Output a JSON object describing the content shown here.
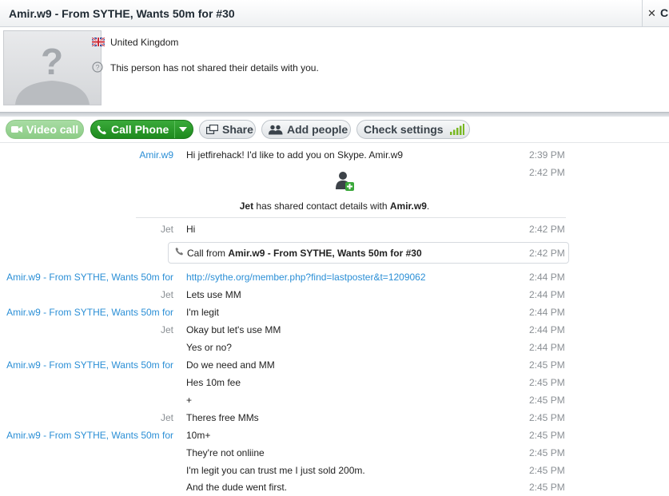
{
  "window": {
    "title": "Amir.w9 - From SYTHE, Wants 50m for #30",
    "next_tab": "C"
  },
  "profile": {
    "country": "United Kingdom",
    "privacy_note": "This person has not shared their details with you."
  },
  "toolbar": {
    "video_call": "Video call",
    "call_phone": "Call Phone",
    "share": "Share",
    "add_people": "Add people",
    "check_settings": "Check settings"
  },
  "messages": [
    {
      "sender": "Amir.w9",
      "side": "remote",
      "text": "Hi jetfirehack! I'd like to add you on Skype. Amir.w9",
      "time": "2:39 PM"
    },
    {
      "sender": "",
      "side": "local",
      "text": "",
      "time": "2:42 PM"
    },
    {
      "sender": "Jet",
      "side": "local",
      "text": "Hi",
      "time": "2:42 PM"
    },
    {
      "sender": "Amir.w9 - From SYTHE, Wants 50m for",
      "side": "remote",
      "text": "http://sythe.org/member.php?find=lastposter&t=1209062",
      "time": "2:44 PM",
      "link": true
    },
    {
      "sender": "Jet",
      "side": "local",
      "text": "Lets use MM",
      "time": "2:44 PM"
    },
    {
      "sender": "Amir.w9 - From SYTHE, Wants 50m for",
      "side": "remote",
      "text": "I'm legit",
      "time": "2:44 PM"
    },
    {
      "sender": "Jet",
      "side": "local",
      "text": "Okay but let's use MM",
      "time": "2:44 PM"
    },
    {
      "sender": "",
      "side": "local",
      "text": "Yes or no?",
      "time": "2:44 PM"
    },
    {
      "sender": "Amir.w9 - From SYTHE, Wants 50m for",
      "side": "remote",
      "text": "Do we need and MM",
      "time": "2:45 PM"
    },
    {
      "sender": "",
      "side": "remote",
      "text": "Hes 10m fee",
      "time": "2:45 PM"
    },
    {
      "sender": "",
      "side": "remote",
      "text": "+",
      "time": "2:45 PM"
    },
    {
      "sender": "Jet",
      "side": "local",
      "text": "Theres free MMs",
      "time": "2:45 PM"
    },
    {
      "sender": "Amir.w9 - From SYTHE, Wants 50m for",
      "side": "remote",
      "text": "10m+",
      "time": "2:45 PM"
    },
    {
      "sender": "",
      "side": "remote",
      "text": "They're not onliine",
      "time": "2:45 PM"
    },
    {
      "sender": "",
      "side": "remote",
      "text": "I'm legit you can trust me I just sold 200m.",
      "time": "2:45 PM"
    },
    {
      "sender": "",
      "side": "remote",
      "text": "And the dude went first.",
      "time": "2:45 PM"
    }
  ],
  "shared_contact": {
    "from": "Jet",
    "middle": " has shared contact details with ",
    "to": "Amir.w9",
    "end": "."
  },
  "call_event": {
    "prefix": "Call from ",
    "caller": "Amir.w9 - From SYTHE, Wants 50m for #30",
    "time": "2:42 PM"
  },
  "colors": {
    "link": "#2b8fd6",
    "call_green": "#1e8a1e",
    "video_green": "#8ccc86"
  }
}
